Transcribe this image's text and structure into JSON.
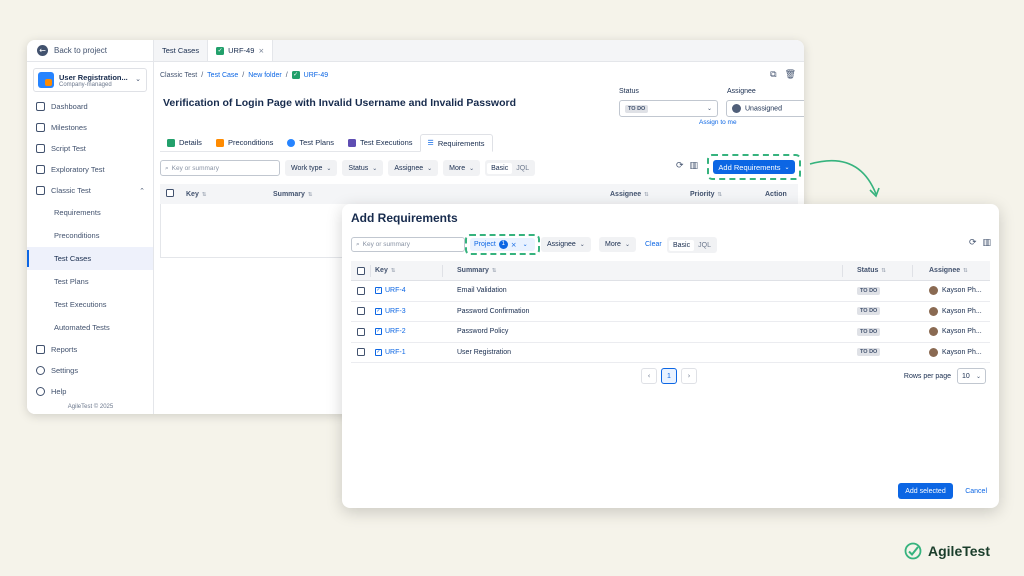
{
  "sidebar": {
    "back": "Back to project",
    "project_name": "User Registration...",
    "project_type": "Company-managed",
    "items": [
      {
        "label": "Dashboard"
      },
      {
        "label": "Milestones"
      },
      {
        "label": "Script Test"
      },
      {
        "label": "Exploratory Test"
      },
      {
        "label": "Classic Test"
      },
      {
        "label": "Requirements"
      },
      {
        "label": "Preconditions"
      },
      {
        "label": "Test Cases"
      },
      {
        "label": "Test Plans"
      },
      {
        "label": "Test Executions"
      },
      {
        "label": "Automated Tests"
      },
      {
        "label": "Reports"
      },
      {
        "label": "Settings"
      },
      {
        "label": "Help"
      }
    ],
    "footer": "AgileTest © 2025"
  },
  "tabs": {
    "t1": "Test Cases",
    "t2": "URF-49"
  },
  "breadcrumb": {
    "c1": "Classic Test",
    "c2": "Test Case",
    "c3": "New folder",
    "c4": "URF-49"
  },
  "page_title": "Verification of Login Page with Invalid Username and Invalid Password",
  "status": {
    "label": "Status",
    "value": "TO DO"
  },
  "assignee": {
    "label": "Assignee",
    "value": "Unassigned",
    "assign_me": "Assign to me"
  },
  "detail_tabs": [
    "Details",
    "Preconditions",
    "Test Plans",
    "Test Executions",
    "Requirements"
  ],
  "toolbar": {
    "search_placeholder": "Key or summary",
    "work_type": "Work type",
    "status": "Status",
    "assignee": "Assignee",
    "more": "More",
    "basic": "Basic",
    "jql": "JQL",
    "add_requirements": "Add Requirements"
  },
  "table": {
    "key": "Key",
    "summary": "Summary",
    "assignee": "Assignee",
    "priority": "Priority",
    "action": "Action"
  },
  "modal": {
    "title": "Add Requirements",
    "search_placeholder": "Key or summary",
    "project": "Project",
    "project_count": "1",
    "assignee": "Assignee",
    "more": "More",
    "clear": "Clear",
    "basic": "Basic",
    "jql": "JQL",
    "headers": {
      "key": "Key",
      "summary": "Summary",
      "status": "Status",
      "assignee": "Assignee"
    },
    "rows": [
      {
        "key": "URF-4",
        "summary": "Email Validation",
        "status": "TO DO",
        "assignee": "Kayson Ph..."
      },
      {
        "key": "URF-3",
        "summary": "Password Confirmation",
        "status": "TO DO",
        "assignee": "Kayson Ph..."
      },
      {
        "key": "URF-2",
        "summary": "Password Policy",
        "status": "TO DO",
        "assignee": "Kayson Ph..."
      },
      {
        "key": "URF-1",
        "summary": "User Registration",
        "status": "TO DO",
        "assignee": "Kayson Ph..."
      }
    ],
    "page": "1",
    "rows_per_page_label": "Rows per page",
    "rows_per_page": "10",
    "add_selected": "Add selected",
    "cancel": "Cancel"
  },
  "brand": {
    "name": "AgileTest",
    "color": "#36b37e"
  }
}
